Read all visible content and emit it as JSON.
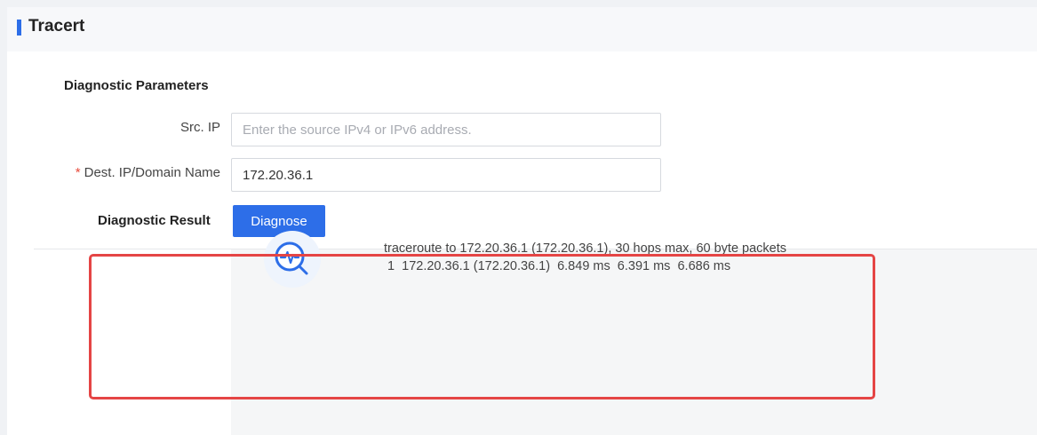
{
  "header": {
    "title": "Tracert",
    "accent_color": "#2d6ee8"
  },
  "params": {
    "section_title": "Diagnostic Parameters",
    "src_ip": {
      "label": "Src. IP",
      "value": "",
      "placeholder": "Enter the source IPv4 or IPv6 address."
    },
    "dest_ip": {
      "required_mark": "*",
      "label": "Dest. IP/Domain Name",
      "value": "172.20.36.1",
      "placeholder": ""
    },
    "diagnose_label": "Diagnose"
  },
  "result": {
    "section_title": "Diagnostic Result",
    "icon": "diagnostic-search-icon",
    "lines": [
      "traceroute to 172.20.36.1 (172.20.36.1), 30 hops max, 60 byte packets",
      " 1  172.20.36.1 (172.20.36.1)  6.849 ms  6.391 ms  6.686 ms"
    ]
  },
  "annotation_color": "#e54545"
}
